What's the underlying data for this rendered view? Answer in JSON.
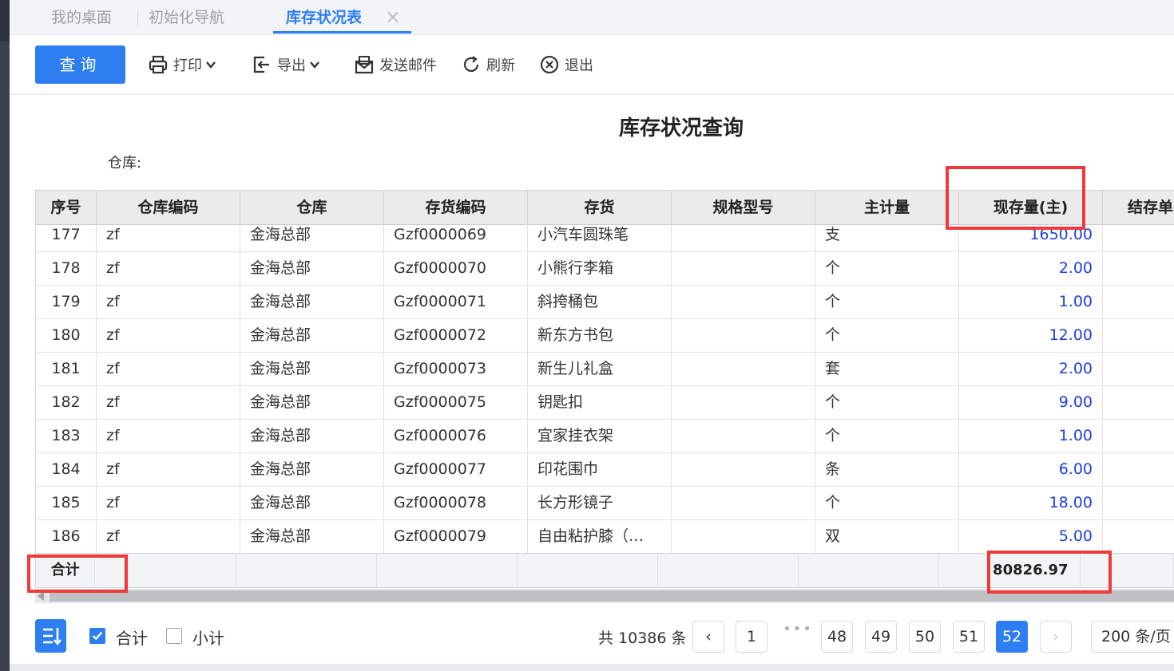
{
  "tabs": [
    {
      "label": "我的桌面"
    },
    {
      "label": "初始化导航"
    },
    {
      "label": "库存状况表"
    }
  ],
  "toolbar": {
    "query": "查询",
    "print": "打印",
    "export": "导出",
    "send_mail": "发送邮件",
    "refresh": "刷新",
    "exit": "退出"
  },
  "report": {
    "title": "库存状况查询",
    "warehouse_label": "仓库:"
  },
  "table": {
    "columns": [
      "序号",
      "仓库编码",
      "仓库",
      "存货编码",
      "存货",
      "规格型号",
      "主计量",
      "现存量(主)",
      "结存单"
    ],
    "rows": [
      {
        "no": "177",
        "wh_code": "zf",
        "wh": "金海总部",
        "inv_code": "Gzf0000069",
        "inv": "小汽车圆珠笔",
        "spec": "",
        "unit": "支",
        "qty": "1650.00"
      },
      {
        "no": "178",
        "wh_code": "zf",
        "wh": "金海总部",
        "inv_code": "Gzf0000070",
        "inv": "小熊行李箱",
        "spec": "",
        "unit": "个",
        "qty": "2.00"
      },
      {
        "no": "179",
        "wh_code": "zf",
        "wh": "金海总部",
        "inv_code": "Gzf0000071",
        "inv": "斜挎桶包",
        "spec": "",
        "unit": "个",
        "qty": "1.00"
      },
      {
        "no": "180",
        "wh_code": "zf",
        "wh": "金海总部",
        "inv_code": "Gzf0000072",
        "inv": "新东方书包",
        "spec": "",
        "unit": "个",
        "qty": "12.00"
      },
      {
        "no": "181",
        "wh_code": "zf",
        "wh": "金海总部",
        "inv_code": "Gzf0000073",
        "inv": "新生儿礼盒",
        "spec": "",
        "unit": "套",
        "qty": "2.00"
      },
      {
        "no": "182",
        "wh_code": "zf",
        "wh": "金海总部",
        "inv_code": "Gzf0000075",
        "inv": "钥匙扣",
        "spec": "",
        "unit": "个",
        "qty": "9.00"
      },
      {
        "no": "183",
        "wh_code": "zf",
        "wh": "金海总部",
        "inv_code": "Gzf0000076",
        "inv": "宜家挂衣架",
        "spec": "",
        "unit": "个",
        "qty": "1.00"
      },
      {
        "no": "184",
        "wh_code": "zf",
        "wh": "金海总部",
        "inv_code": "Gzf0000077",
        "inv": "印花围巾",
        "spec": "",
        "unit": "条",
        "qty": "6.00"
      },
      {
        "no": "185",
        "wh_code": "zf",
        "wh": "金海总部",
        "inv_code": "Gzf0000078",
        "inv": "长方形镜子",
        "spec": "",
        "unit": "个",
        "qty": "18.00"
      },
      {
        "no": "186",
        "wh_code": "zf",
        "wh": "金海总部",
        "inv_code": "Gzf0000079",
        "inv": "自由粘护膝（…",
        "spec": "",
        "unit": "双",
        "qty": "5.00"
      }
    ],
    "total_label": "合计",
    "total_value": "80826.97"
  },
  "footer": {
    "total_check_label": "合计",
    "subtotal_check_label": "小计",
    "total_count": "共 10386 条",
    "pages": [
      "1",
      "48",
      "49",
      "50",
      "51",
      "52"
    ],
    "ellipsis": "•••",
    "current_page": "52",
    "prev": "‹",
    "next": "›",
    "page_size": "200 条/页"
  },
  "colors": {
    "accent": "#2d7ef0",
    "highlight": "#ee3a3a",
    "qty_text": "#1f3fd6"
  },
  "icons": [
    "printer-icon",
    "chevron-down-icon",
    "export-icon",
    "mail-icon",
    "refresh-icon",
    "close-circle-icon",
    "sort-icon",
    "check-icon"
  ]
}
